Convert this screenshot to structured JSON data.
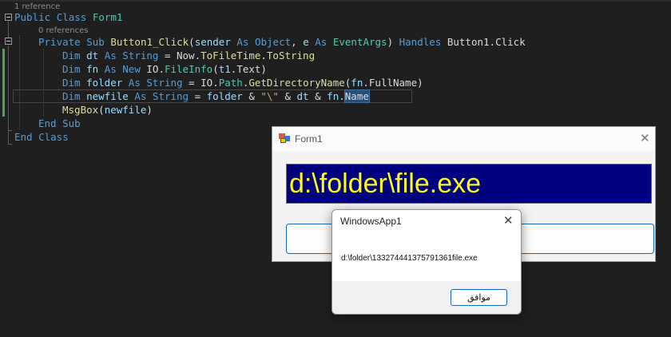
{
  "editor": {
    "codelens_class": "1 reference",
    "codelens_sub": "0 references",
    "lines": {
      "l1": [
        "Public ",
        "Class ",
        "Form1"
      ],
      "l2": [
        "Private ",
        "Sub ",
        "Button1_Click",
        "(",
        "sender ",
        "As ",
        "Object",
        ", ",
        "e ",
        "As ",
        "EventArgs",
        ") ",
        "Handles ",
        "Button1",
        ".",
        "Click"
      ],
      "l3": [
        "Dim ",
        "dt ",
        "As ",
        "String",
        " = ",
        "Now",
        ".",
        "ToFileTime",
        ".",
        "ToString"
      ],
      "l4": [
        "Dim ",
        "fn ",
        "As ",
        "New ",
        "IO",
        ".",
        "FileInfo",
        "(",
        "t1",
        ".",
        "Text",
        ")"
      ],
      "l5": [
        "Dim ",
        "folder ",
        "As ",
        "String",
        " = ",
        "IO",
        ".",
        "Path",
        ".",
        "GetDirectoryName",
        "(",
        "fn",
        ".",
        "FullName",
        ")"
      ],
      "l6": [
        "Dim ",
        "newfile ",
        "As ",
        "String",
        " = ",
        "folder",
        " & ",
        "\"\\\"",
        " & ",
        "dt",
        " & ",
        "fn",
        ".",
        "Name"
      ],
      "l7": [
        "MsgBox",
        "(",
        "newfile",
        ")"
      ],
      "l8": [
        "End ",
        "Sub"
      ],
      "l9": [
        "End ",
        "Class"
      ]
    }
  },
  "form1": {
    "title": "Form1",
    "close_glyph": "✕",
    "textbox_value": "d:\\folder\\file.exe",
    "button_label": ""
  },
  "msgbox": {
    "title": "WindowsApp1",
    "close_glyph": "✕",
    "message": "d:\\folder\\133274441375791361file.exe",
    "ok_label": "موافق"
  },
  "colors": {
    "editor_bg": "#1f1f1f",
    "keyword": "#569cd6",
    "type": "#4ec9b0",
    "method": "#dcdcaa",
    "identifier": "#9cdcfe",
    "string": "#d69d85",
    "textbox_bg": "#00007f",
    "textbox_fg": "#ffff00",
    "accent": "#0f6cbd"
  }
}
